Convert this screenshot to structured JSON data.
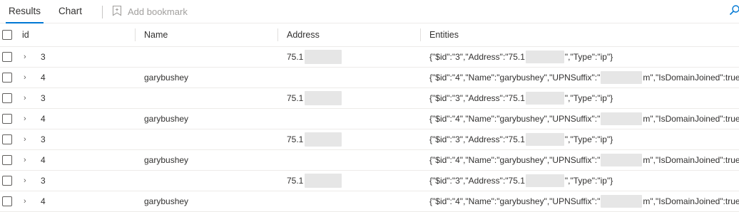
{
  "toolbar": {
    "tab_results": "Results",
    "tab_chart": "Chart",
    "add_bookmark": "Add bookmark"
  },
  "table": {
    "headers": {
      "id": "id",
      "name": "Name",
      "address": "Address",
      "entities": "Entities"
    },
    "rows": [
      {
        "id": "3",
        "name": "",
        "address": "75.1",
        "ent_a": "{\"$id\":\"3\",\"Address\":\"75.1",
        "ent_b": "\",\"Type\":\"ip\"}"
      },
      {
        "id": "4",
        "name": "garybushey",
        "address": "",
        "ent_a": "{\"$id\":\"4\",\"Name\":\"garybushey\",\"UPNSuffix\":\"",
        "ent_b": "m\",\"IsDomainJoined\":true,\""
      },
      {
        "id": "3",
        "name": "",
        "address": "75.1",
        "ent_a": "{\"$id\":\"3\",\"Address\":\"75.1",
        "ent_b": "\",\"Type\":\"ip\"}"
      },
      {
        "id": "4",
        "name": "garybushey",
        "address": "",
        "ent_a": "{\"$id\":\"4\",\"Name\":\"garybushey\",\"UPNSuffix\":\"",
        "ent_b": "m\",\"IsDomainJoined\":true,\""
      },
      {
        "id": "3",
        "name": "",
        "address": "75.1",
        "ent_a": "{\"$id\":\"3\",\"Address\":\"75.1",
        "ent_b": "\",\"Type\":\"ip\"}"
      },
      {
        "id": "4",
        "name": "garybushey",
        "address": "",
        "ent_a": "{\"$id\":\"4\",\"Name\":\"garybushey\",\"UPNSuffix\":\"",
        "ent_b": "m\",\"IsDomainJoined\":true,\""
      },
      {
        "id": "3",
        "name": "",
        "address": "75.1",
        "ent_a": "{\"$id\":\"3\",\"Address\":\"75.1",
        "ent_b": "\",\"Type\":\"ip\"}"
      },
      {
        "id": "4",
        "name": "garybushey",
        "address": "",
        "ent_a": "{\"$id\":\"4\",\"Name\":\"garybushey\",\"UPNSuffix\":\"",
        "ent_b": "m\",\"IsDomainJoined\":true,\""
      }
    ]
  },
  "icons": {
    "expand": "chevron-right-icon",
    "bookmark": "bookmark-icon",
    "search": "search-icon"
  },
  "colors": {
    "accent": "#0078d4",
    "border": "#edebe9",
    "disabled": "#a19f9d"
  }
}
